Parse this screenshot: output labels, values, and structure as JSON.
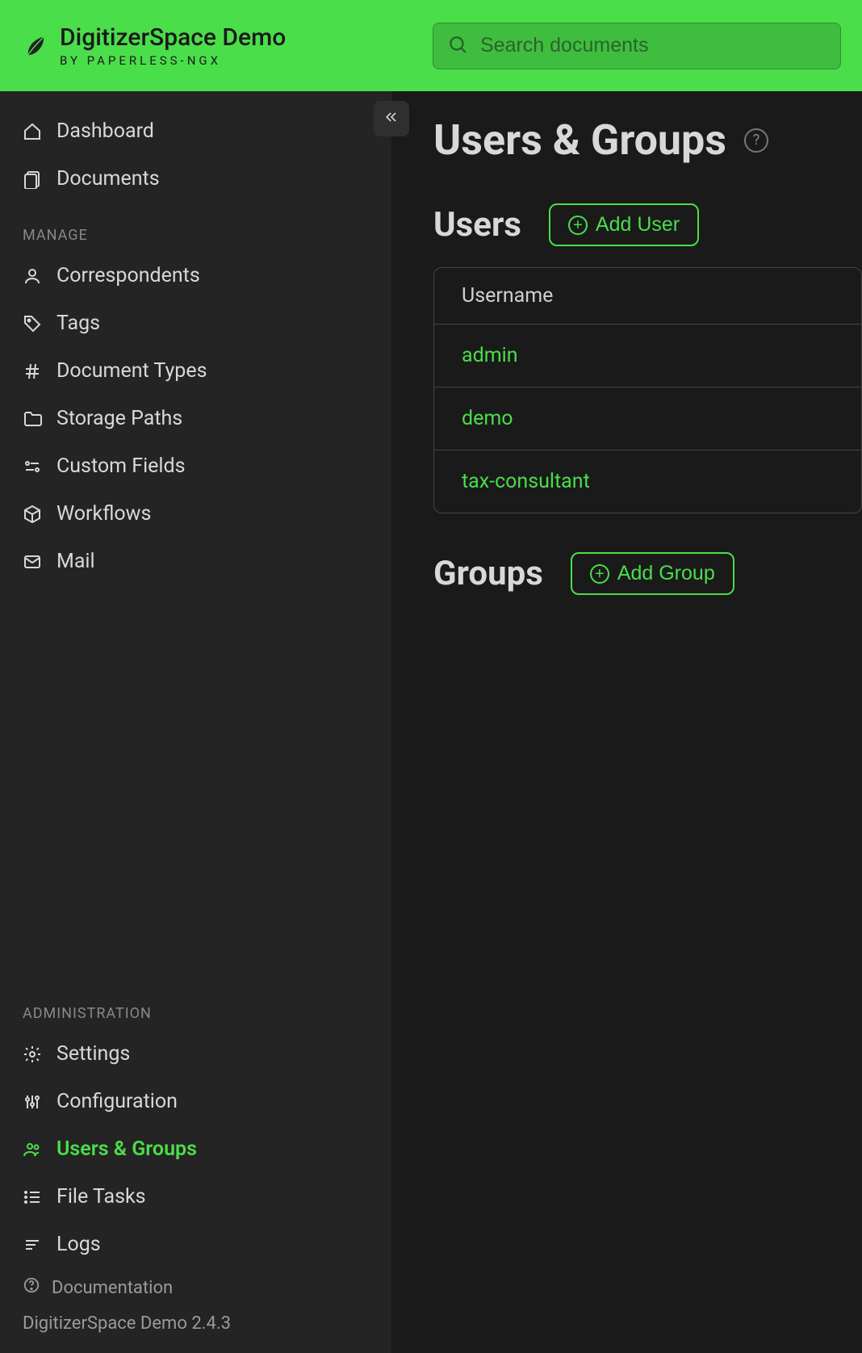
{
  "header": {
    "brand_title": "DigitizerSpace Demo",
    "brand_sub": "BY PAPERLESS-NGX",
    "search_placeholder": "Search documents"
  },
  "sidebar": {
    "top": [
      {
        "label": "Dashboard"
      },
      {
        "label": "Documents"
      }
    ],
    "manage_label": "MANAGE",
    "manage": [
      {
        "label": "Correspondents"
      },
      {
        "label": "Tags"
      },
      {
        "label": "Document Types"
      },
      {
        "label": "Storage Paths"
      },
      {
        "label": "Custom Fields"
      },
      {
        "label": "Workflows"
      },
      {
        "label": "Mail"
      }
    ],
    "admin_label": "ADMINISTRATION",
    "admin": [
      {
        "label": "Settings"
      },
      {
        "label": "Configuration"
      },
      {
        "label": "Users & Groups",
        "active": true
      },
      {
        "label": "File Tasks"
      },
      {
        "label": "Logs"
      }
    ],
    "documentation": "Documentation",
    "version": "DigitizerSpace Demo 2.4.3"
  },
  "main": {
    "page_title": "Users & Groups",
    "users_title": "Users",
    "add_user": "Add User",
    "table_header": "Username",
    "users": [
      {
        "username": "admin"
      },
      {
        "username": "demo"
      },
      {
        "username": "tax-consultant"
      }
    ],
    "groups_title": "Groups",
    "add_group": "Add Group"
  }
}
